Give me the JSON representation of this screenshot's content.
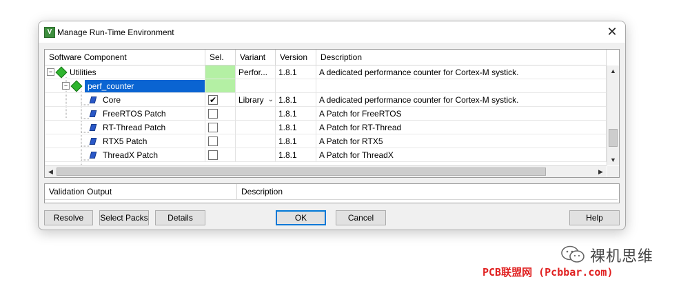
{
  "window": {
    "title": "Manage Run-Time Environment",
    "close_symbol": "✕"
  },
  "grid": {
    "headers": {
      "component": "Software Component",
      "sel": "Sel.",
      "variant": "Variant",
      "version": "Version",
      "description": "Description"
    },
    "rows": [
      {
        "component": "Utilities",
        "variant": "Perfor...",
        "version": "1.8.1",
        "description": "A dedicated performance counter for Cortex-M systick."
      },
      {
        "component": "perf_counter",
        "variant": "",
        "version": "",
        "description": ""
      },
      {
        "component": "Core",
        "variant": "Library",
        "version": "1.8.1",
        "description": "A dedicated performance counter for Cortex-M systick.",
        "checked": "✔"
      },
      {
        "component": "FreeRTOS Patch",
        "variant": "",
        "version": "1.8.1",
        "description": "A Patch for FreeRTOS"
      },
      {
        "component": "RT-Thread Patch",
        "variant": "",
        "version": "1.8.1",
        "description": "A Patch for RT-Thread"
      },
      {
        "component": "RTX5 Patch",
        "variant": "",
        "version": "1.8.1",
        "description": "A Patch for RTX5"
      },
      {
        "component": "ThreadX Patch",
        "variant": "",
        "version": "1.8.1",
        "description": "A Patch for ThreadX"
      }
    ],
    "tree_toggle": "−"
  },
  "validation": {
    "headers": {
      "output": "Validation Output",
      "description": "Description"
    }
  },
  "buttons": {
    "resolve": "Resolve",
    "select_packs": "Select Packs",
    "details": "Details",
    "ok": "OK",
    "cancel": "Cancel",
    "help": "Help"
  },
  "watermark": {
    "name": "裸机思维",
    "url": "PCB联盟网 (Pcbbar.com)"
  },
  "colors": {
    "selection": "#0a64d2",
    "sel_green": "#b4f0a4",
    "component_gem": "#2fb52f",
    "sub_component": "#2a58c8"
  }
}
